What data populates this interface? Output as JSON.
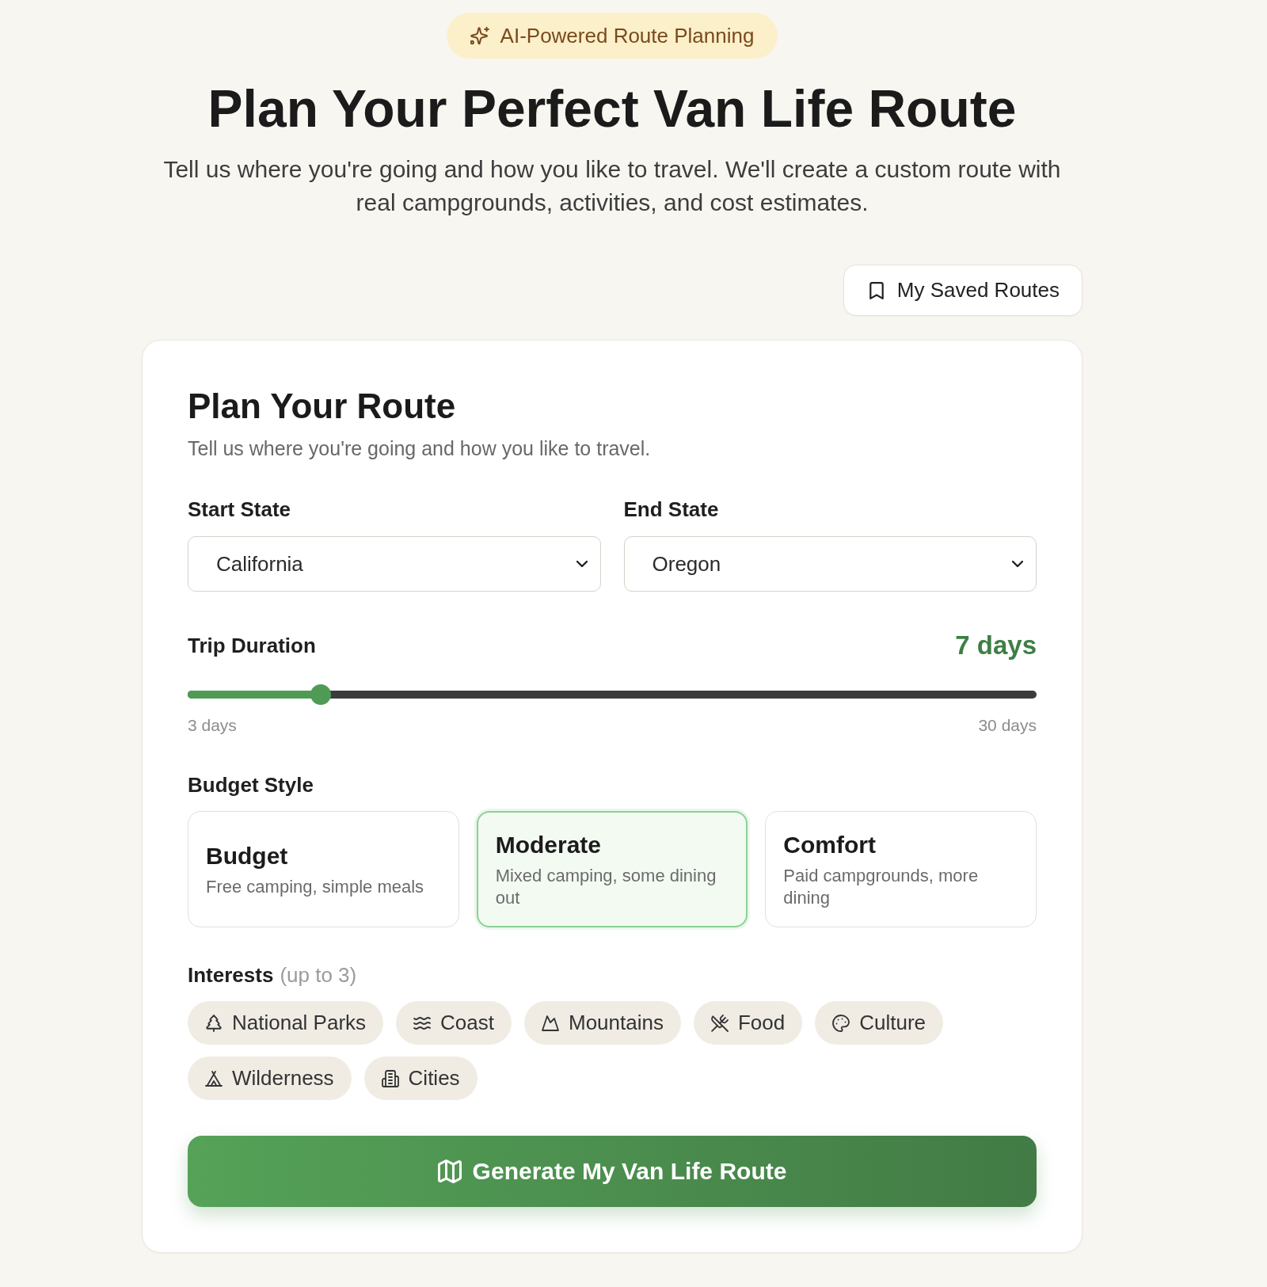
{
  "badge": {
    "label": "AI-Powered Route Planning"
  },
  "hero": {
    "title": "Plan Your Perfect Van Life Route",
    "subtitle": "Tell us where you're going and how you like to travel. We'll create a custom route with real campgrounds, activities, and cost estimates."
  },
  "saved_routes_button": {
    "label": "My Saved Routes"
  },
  "form": {
    "title": "Plan Your Route",
    "subtitle": "Tell us where you're going and how you like to travel.",
    "selects": [
      {
        "label": "Start State",
        "value": "California"
      },
      {
        "label": "End State",
        "value": "Oregon"
      }
    ],
    "duration": {
      "label": "Trip Duration",
      "reading": "7 days",
      "level": 0.148,
      "min_label": "3 days",
      "max_label": "30 days"
    },
    "budget": {
      "label": "Budget Style",
      "options": [
        {
          "title": "Budget",
          "description": "Free camping, simple meals",
          "selected": false
        },
        {
          "title": "Moderate",
          "description": "Mixed camping, some dining out",
          "selected": true
        },
        {
          "title": "Comfort",
          "description": "Paid campgrounds, more dining",
          "selected": false
        }
      ]
    },
    "interests": {
      "label": "Interests",
      "hint": "(up to 3)",
      "chips": [
        {
          "label": "National Parks",
          "kind": "tree",
          "selected": false
        },
        {
          "label": "Coast",
          "kind": "waves",
          "selected": false
        },
        {
          "label": "Mountains",
          "kind": "mountain",
          "selected": false
        },
        {
          "label": "Food",
          "kind": "utensils",
          "selected": false
        },
        {
          "label": "Culture",
          "kind": "palette",
          "selected": false
        },
        {
          "label": "Wilderness",
          "kind": "tent",
          "selected": false
        },
        {
          "label": "Cities",
          "kind": "building",
          "selected": false
        }
      ]
    },
    "submit_button": {
      "label": "Generate My Van Life Route"
    }
  }
}
